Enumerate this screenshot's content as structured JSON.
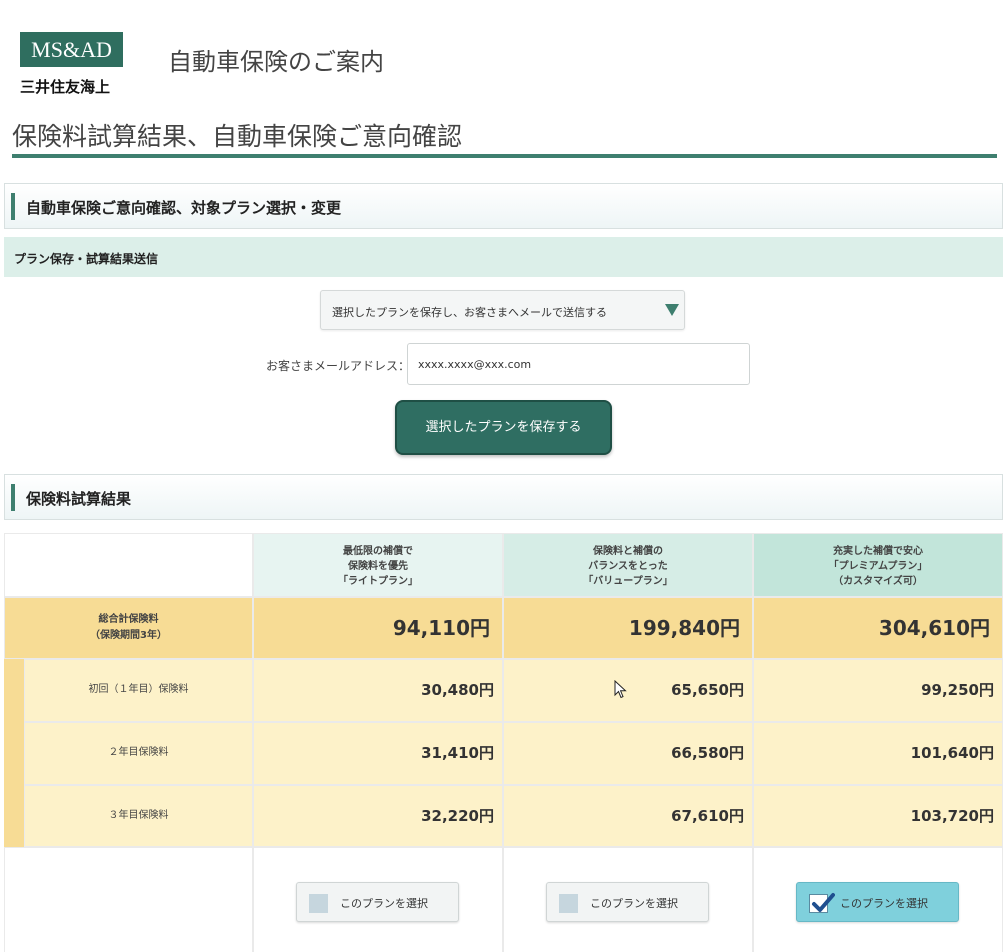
{
  "header": {
    "logo_text": "MS&AD",
    "company": "三井住友海上",
    "site_title": "自動車保険のご案内"
  },
  "page_title": "保険料試算結果、自動車保険ご意向確認",
  "section1": {
    "title": "自動車保険ご意向確認、対象プラン選択・変更",
    "subsection_title": "プラン保存・試算結果送信",
    "dropdown_selected": "選択したプランを保存し、お客さまへメールで送信する",
    "email_label": "お客さまメールアドレス：",
    "email_value": "xxxx.xxxx@xxx.com",
    "save_button": "選択したプランを保存する"
  },
  "section2": {
    "title": "保険料試算結果"
  },
  "plans": [
    {
      "header": "最低限の補償で\n保険料を優先\n「ライトプラン」",
      "total": "94,110円",
      "year1": "30,480円",
      "year2": "31,410円",
      "year3": "32,220円",
      "select_label": "このプランを選択",
      "selected": false
    },
    {
      "header": "保険料と補償の\nバランスをとった\n「バリュープラン」",
      "total": "199,840円",
      "year1": "65,650円",
      "year2": "66,580円",
      "year3": "67,610円",
      "select_label": "このプランを選択",
      "selected": false
    },
    {
      "header": "充実した補償で安心\n「プレミアムプラン」\n（カスタマイズ可）",
      "total": "304,610円",
      "year1": "99,250円",
      "year2": "101,640円",
      "year3": "103,720円",
      "select_label": "このプランを選択",
      "selected": true
    }
  ],
  "row_labels": {
    "total": "総合計保険料\n（保険期間3年）",
    "year1": "初回（１年目）保険料",
    "year2": "２年目保険料",
    "year3": "３年目保険料"
  },
  "colors": {
    "brand_green": "#2f6e5f",
    "total_row": "#f7dc95",
    "year_rows": "#fdf2c9",
    "selected_button": "#7fd0dc"
  },
  "icons": {
    "dropdown": "triangle-down-icon",
    "check": "checkmark-icon",
    "cursor": "mouse-pointer-icon"
  }
}
